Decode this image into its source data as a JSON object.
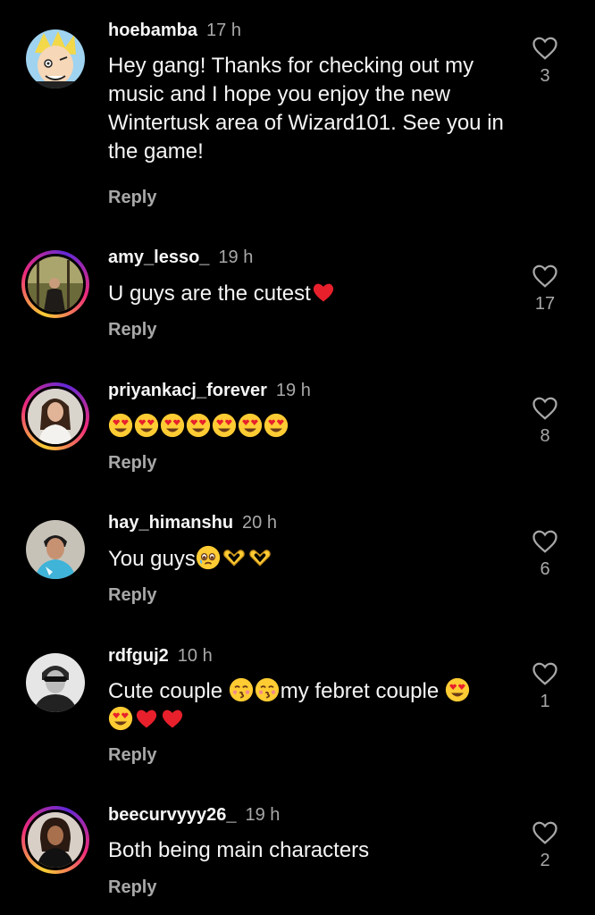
{
  "comments": [
    {
      "username": "hoebamba",
      "time": "17 h",
      "text": "Hey gang! Thanks for checking out my music and I hope you enjoy the new Wintertusk area of Wizard101. See you in the game!",
      "reply_label": "Reply",
      "like_count": "3",
      "avatar": "cartoon-avatar",
      "has_story_ring": false
    },
    {
      "username": "amy_lesso_",
      "time": "19 h",
      "text": "U guys are the cutest",
      "emojis": [
        "red-heart"
      ],
      "reply_label": "Reply",
      "like_count": "17",
      "avatar": "photo-avatar",
      "has_story_ring": true
    },
    {
      "username": "priyankacj_forever",
      "time": "19 h",
      "text": "",
      "emojis": [
        "heart-eyes-face",
        "heart-eyes-face",
        "heart-eyes-face",
        "heart-eyes-face",
        "heart-eyes-face",
        "heart-eyes-face",
        "heart-eyes-face"
      ],
      "reply_label": "Reply",
      "like_count": "8",
      "avatar": "photo-avatar",
      "has_story_ring": true
    },
    {
      "username": "hay_himanshu",
      "time": "20 h",
      "text": "You guys",
      "emojis": [
        "holding-back-tears-face",
        "heart-hands",
        "heart-hands"
      ],
      "reply_label": "Reply",
      "like_count": "6",
      "avatar": "photo-avatar",
      "has_story_ring": false
    },
    {
      "username": "rdfguj2",
      "time": "10 h",
      "text_part1": "Cute couple",
      "text_part2": "my febret couple",
      "emojis_part1": [
        "kissing-face",
        "kissing-face"
      ],
      "emojis_part2": [
        "heart-eyes-face",
        "heart-eyes-face",
        "red-heart",
        "red-heart"
      ],
      "reply_label": "Reply",
      "like_count": "1",
      "avatar": "photo-avatar",
      "has_story_ring": false
    },
    {
      "username": "beecurvyyy26_",
      "time": "19 h",
      "text": "Both being main characters",
      "reply_label": "Reply",
      "like_count": "2",
      "avatar": "photo-avatar",
      "has_story_ring": true
    }
  ],
  "colors": {
    "background": "#000000",
    "text": "#f5f5f5",
    "secondary": "#a8a8a8",
    "heart_red": "#e0245e"
  }
}
